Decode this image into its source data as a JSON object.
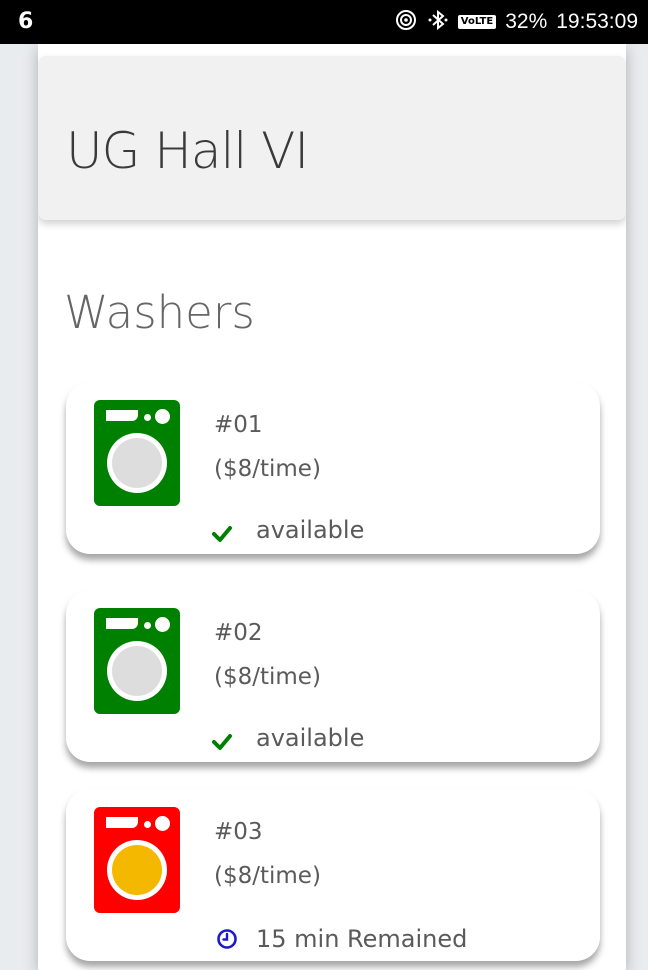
{
  "statusbar": {
    "left_glyph": "6",
    "volte": "VoLTE",
    "battery": "32%",
    "time": "19:53:09"
  },
  "colors": {
    "available": "#008000",
    "busy": "#ff0000",
    "drum_available": "#dddddd",
    "drum_busy": "#f5b800",
    "clock": "#1a1acc"
  },
  "header": {
    "title": "UG Hall VI"
  },
  "section": {
    "title": "Washers"
  },
  "washers": [
    {
      "number": "#01",
      "price": "($8/time)",
      "status": "available",
      "state": "available",
      "icon": "check-icon"
    },
    {
      "number": "#02",
      "price": "($8/time)",
      "status": "available",
      "state": "available",
      "icon": "check-icon"
    },
    {
      "number": "#03",
      "price": "($8/time)",
      "status": "15 min Remained",
      "state": "busy",
      "icon": "clock-icon"
    }
  ]
}
